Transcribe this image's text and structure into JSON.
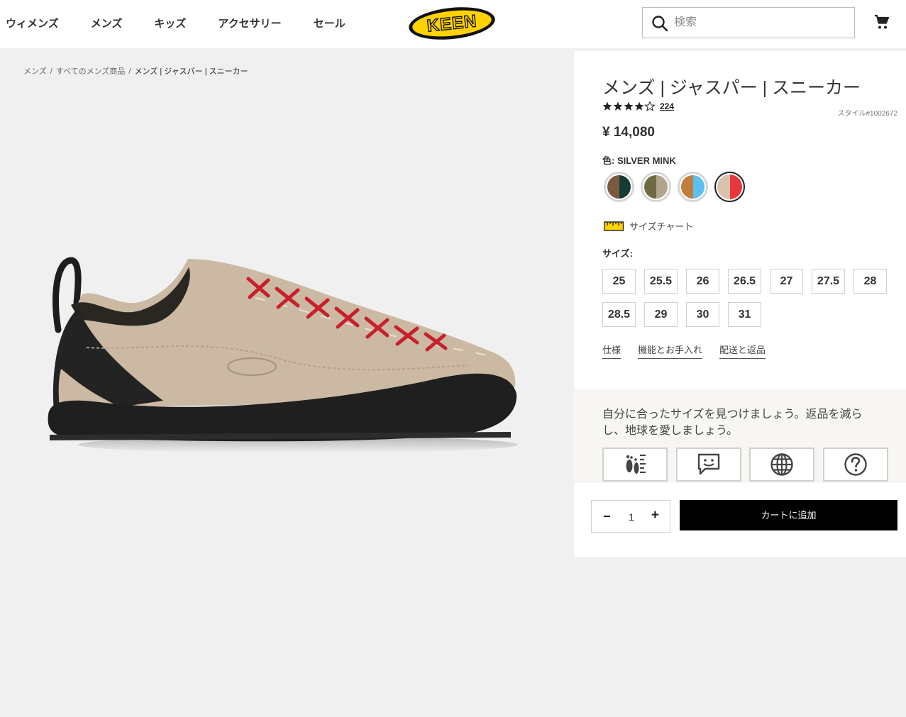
{
  "nav": {
    "items": [
      {
        "label": "ウィメンズ"
      },
      {
        "label": "メンズ"
      },
      {
        "label": "キッズ"
      },
      {
        "label": "アクセサリー"
      },
      {
        "label": "セール"
      }
    ]
  },
  "logo": {
    "text": "KEEN",
    "icon": "keen-logo"
  },
  "search": {
    "placeholder": "検索",
    "icon": "search-icon"
  },
  "cart": {
    "icon": "shopping-cart-icon"
  },
  "breadcrumb": {
    "items": [
      "メンズ",
      "すべてのメンズ商品",
      "メンズ | ジャスパー | スニーカー"
    ],
    "separator": "/"
  },
  "product": {
    "title": "メンズ | ジャスパー | スニーカー",
    "rating": 4.5,
    "review_count": "224",
    "style": "スタイル#1002672",
    "price": "¥ 14,080",
    "color_label": "色:",
    "color_value": "SILVER MINK",
    "swatches": [
      {
        "name": "brown-dark-green",
        "colors": [
          "#7a5a3e",
          "#163a35"
        ],
        "selected": false
      },
      {
        "name": "olive-tan",
        "colors": [
          "#6e6a44",
          "#b1a48c"
        ],
        "selected": false
      },
      {
        "name": "caramel-sky",
        "colors": [
          "#c07d3c",
          "#5bbff0"
        ],
        "selected": false
      },
      {
        "name": "silver-mink",
        "colors": [
          "#d9c3ad",
          "#e8383d"
        ],
        "selected": true
      }
    ],
    "size_chart_label": "サイズチャート",
    "size_label": "サイズ:",
    "sizes": [
      "25",
      "25.5",
      "26",
      "26.5",
      "27",
      "27.5",
      "28",
      "28.5",
      "29",
      "30",
      "31"
    ],
    "tabs": [
      "仕様",
      "機能とお手入れ",
      "配送と返品"
    ]
  },
  "fit_finder": {
    "text": "自分に合ったサイズを見つけましょう。返品を減らし、地球を愛しましょう。",
    "buttons": [
      "foot-measure-icon",
      "chat-icon",
      "globe-icon",
      "help-icon"
    ]
  },
  "purchase": {
    "quantity": "1",
    "minus": "−",
    "plus": "+",
    "add_to_cart": "カートに追加"
  },
  "colors": {
    "accent_yellow": "#ffd200",
    "button_black": "#000000",
    "page_bg": "#f0f0f0"
  }
}
